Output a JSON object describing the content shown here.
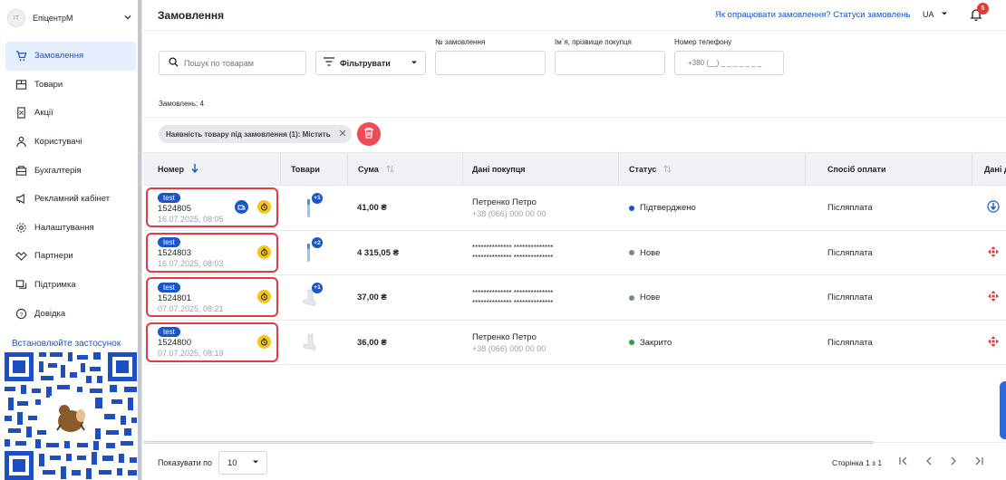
{
  "sidebar": {
    "store": {
      "avatar": "IT",
      "name": "ЕпіцентрМ"
    },
    "items": [
      {
        "label": "Замовлення",
        "icon": "cart-icon",
        "active": true
      },
      {
        "label": "Товари",
        "icon": "goods-icon"
      },
      {
        "label": "Акції",
        "icon": "discount-icon"
      },
      {
        "label": "Користувачі",
        "icon": "users-icon"
      },
      {
        "label": "Бухгалтерія",
        "icon": "accounting-icon"
      },
      {
        "label": "Рекламний кабінет",
        "icon": "megaphone-icon"
      },
      {
        "label": "Налаштування",
        "icon": "gear-icon"
      },
      {
        "label": "Партнери",
        "icon": "handshake-icon"
      },
      {
        "label": "Підтримка",
        "icon": "chat-icon"
      },
      {
        "label": "Довідка",
        "icon": "help-icon"
      }
    ],
    "install_label": "Встановлюйте застосунок"
  },
  "header": {
    "title": "Замовлення",
    "help_link": "Як опрацювати замовлення? Статуси замовлень",
    "lang": "UA",
    "notif_count": "5"
  },
  "filters": {
    "search_placeholder": "Пошук по товарам",
    "filter_button": "Фільтрувати",
    "order_label": "№ замовлення",
    "name_label": "Ім`я, прізвище покупця",
    "phone_label": "Номер телефону",
    "phone_placeholder": "+380 (__) _ _ _ _ _ _ _",
    "count": "Замовлень: 4",
    "chip": "Наявність товару під замовлення (1): Містить"
  },
  "table": {
    "headers": {
      "number": "Номер",
      "goods": "Товари",
      "sum": "Сума",
      "buyer": "Дані покупця",
      "status": "Статус",
      "payment": "Спосіб оплати",
      "delivery": "Дані д"
    },
    "rows": [
      {
        "tag": "test",
        "number": "1524805",
        "date": "16.07.2025, 08:05",
        "plus": "+1",
        "sum": "41,00 ₴",
        "buyer_name": "Петренко Петро",
        "buyer_phone": "+38 (066) 000 00 00",
        "status": "Підтверджено",
        "status_color": "#1a56c9",
        "payment": "Післяплата"
      },
      {
        "tag": "test",
        "number": "1524803",
        "date": "16.07.2025, 08:03",
        "plus": "+2",
        "sum": "4 315,05 ₴",
        "buyer_masked_1": "************** **************",
        "buyer_masked_2": "************** **************",
        "status": "Нове",
        "status_color": "#7b8794",
        "payment": "Післяплата"
      },
      {
        "tag": "test",
        "number": "1524801",
        "date": "07.07.2025, 08:21",
        "plus": "+1",
        "sum": "37,00 ₴",
        "buyer_masked_1": "************** **************",
        "buyer_masked_2": "************** **************",
        "status": "Нове",
        "status_color": "#7b8794",
        "payment": "Післяплата"
      },
      {
        "tag": "test",
        "number": "1524800",
        "date": "07.07.2025, 08:19",
        "sum": "36,00 ₴",
        "buyer_name": "Петренко Петро",
        "buyer_phone": "+38 (066) 000 00 00",
        "status": "Закрито",
        "status_color": "#2e9e4f",
        "payment": "Післяплата"
      }
    ]
  },
  "footer": {
    "show_label": "Показувати по",
    "per_page": "10",
    "page_info": "Сторінка 1 з 1"
  }
}
